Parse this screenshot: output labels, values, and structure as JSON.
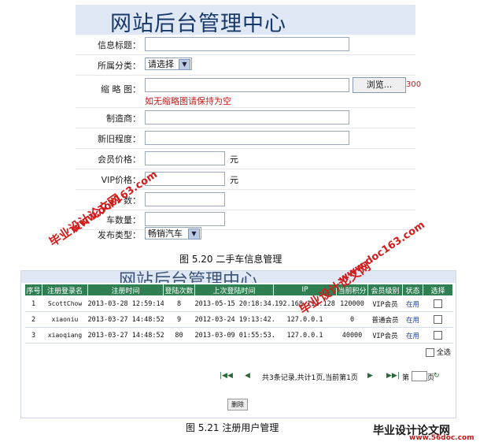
{
  "panel1": {
    "title": "网站后台管理中心",
    "fields": {
      "info_title": "信息标题：",
      "category": "所属分类：",
      "category_select": "请选择",
      "thumbnail": "缩 略 图：",
      "browse": "浏览...",
      "browse_suffix": "300",
      "thumbnail_hint": "如无缩略图请保持为空",
      "maker": "制造商：",
      "condition": "新旧程度：",
      "member_price": "会员价格：",
      "member_price_unit": "元",
      "vip_price": "VIP价格：",
      "vip_price_unit": "元",
      "field8": "数：",
      "quantity": "车数量：",
      "publish_type": "发布类型：",
      "publish_select": "畅销汽车"
    }
  },
  "caption1": "图 5.20  二手车信息管理",
  "panel2": {
    "title": "网站后台管理中心",
    "columns": [
      "序号",
      "注册登录名",
      "注册时间",
      "登陆次数",
      "上次登陆时间",
      "IP",
      "当前积分",
      "会员级别",
      "状态",
      "选择"
    ],
    "rows": [
      [
        "1",
        "ScottChow",
        "2013-03-28 12:59:14.0",
        "8",
        "2013-05-15 20:18:34.0",
        "192.168.111.128",
        "120000",
        "VIP会员",
        "在用"
      ],
      [
        "2",
        "xiaoniu",
        "2013-03-27 14:48:52.0",
        "9",
        "2012-03-24 19:13:42.0",
        "127.0.0.1",
        "0",
        "普通会员",
        "在用"
      ],
      [
        "3",
        "xiaoqiang",
        "2013-03-27 14:48:52.0",
        "80",
        "2013-03-09 01:55:53.0",
        "127.0.0.1",
        "40000",
        "VIP会员",
        "在用"
      ]
    ],
    "select_all": "全选",
    "pager": {
      "summary": "共3条记录,共计1页,当前第1页",
      "page_prefix": "第",
      "page_suffix": "页"
    },
    "delete_button": "删除"
  },
  "caption2": "图 5.21  注册用户管理",
  "watermarks": {
    "site_name": "毕业设计论文网",
    "url": "www.doc163.com",
    "footer_name": "毕业设计论文网",
    "footer_url": "www.56doc.com"
  }
}
